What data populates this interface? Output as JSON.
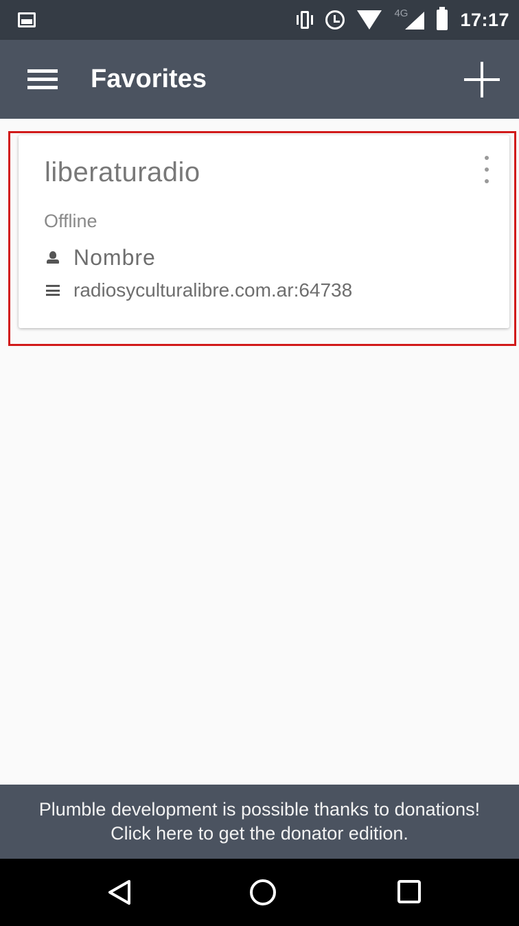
{
  "status_bar": {
    "time": "17:17",
    "network_type": "4G",
    "icons": [
      "gallery-icon",
      "vibrate-icon",
      "alarm-icon",
      "wifi-icon",
      "signal-icon",
      "battery-icon"
    ]
  },
  "app_bar": {
    "title": "Favorites",
    "menu_icon": "menu-icon",
    "add_icon": "add-icon"
  },
  "favorites": [
    {
      "name": "liberaturadio",
      "status": "Offline",
      "username": "Nombre",
      "address": "radiosyculturalibre.com.ar:64738"
    }
  ],
  "donation_banner": {
    "line1": "Plumble development is possible thanks to donations!",
    "line2": "Click here to get the donator edition."
  },
  "nav_bar": {
    "icons": [
      "back-icon",
      "home-icon",
      "recents-icon"
    ]
  },
  "colors": {
    "status_bar_bg": "#353c45",
    "app_bar_bg": "#4b5360",
    "content_bg": "#fafafa",
    "highlight": "#d11a1a",
    "nav_bar_bg": "#000000"
  }
}
